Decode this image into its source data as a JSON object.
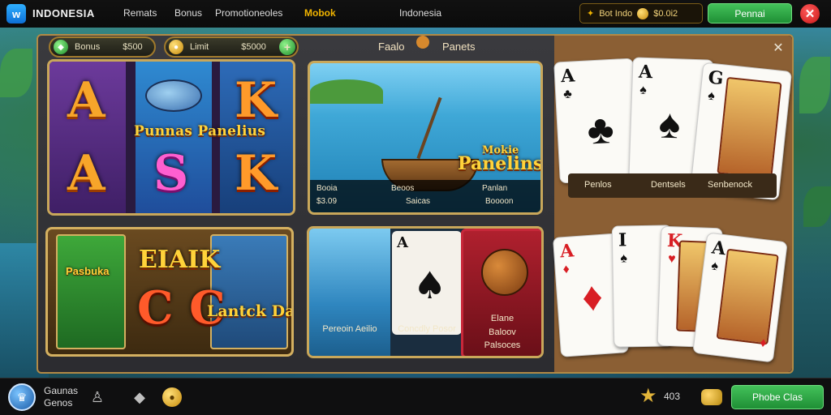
{
  "topbar": {
    "logo_glyph": "w",
    "brand": "INDONESIA",
    "nav": [
      "Remats",
      "Bonus",
      "Promotioneoles",
      "Mobok"
    ],
    "region": "Indonesia",
    "wallet_text": "Bot Indo",
    "wallet_balance": "$0.0i2",
    "action_button": "Pennai",
    "close_glyph": "✕"
  },
  "panel": {
    "stat_left_label": "Bonus",
    "stat_left_value": "$500",
    "stat_right_label": "Limit",
    "stat_right_value": "$5000",
    "title_left": "Faalo",
    "title_right": "Panets",
    "close_glyph": "✕"
  },
  "tiles": {
    "slot": {
      "logo": "Punnas Panelius",
      "symbols": [
        "A",
        "A",
        "S",
        "K",
        "K"
      ]
    },
    "fishing": {
      "logo_top": "Mokie",
      "logo_main": "Panelins",
      "footer": [
        "Booia",
        "$3.09",
        "Beoos",
        "Saicas",
        "Panlan",
        "Boooon"
      ]
    },
    "pirate": {
      "left_label": "Pasbuka",
      "heading": "EIAIK",
      "big": "C C",
      "logo": "Lantck Danius"
    },
    "combo": {
      "card_rank": "A",
      "caption_left": "Pereoin Aeilio",
      "caption_mid": "Concdly Posor",
      "highlight_caption": [
        "Elane",
        "Baloov",
        "Palsoces"
      ]
    }
  },
  "cards_caption": [
    "Penlos",
    "Dentsels",
    "Senbenock"
  ],
  "playing_cards_top": [
    {
      "rank": "A",
      "suit": "♣",
      "color": "black"
    },
    {
      "rank": "A",
      "suit": "♠",
      "color": "black"
    },
    {
      "rank": "G",
      "suit": "♠",
      "color": "black"
    }
  ],
  "playing_cards_bottom": [
    {
      "rank": "A",
      "suit": "♦",
      "color": "red"
    },
    {
      "rank": "I",
      "suit": "♠",
      "color": "black"
    },
    {
      "rank": "K",
      "suit": "♥",
      "color": "red"
    },
    {
      "rank": "A",
      "suit": "♠",
      "color": "black"
    },
    {
      "rank": "A",
      "suit": "♦",
      "color": "red"
    }
  ],
  "bottombar": {
    "username": "Gaunas",
    "subtitle": "Genos",
    "star_value": "403",
    "button": "Phobe Clas"
  },
  "colors": {
    "accent_gold": "#c9a75a",
    "button_green": "#2fa844",
    "close_red": "#d81e24"
  }
}
